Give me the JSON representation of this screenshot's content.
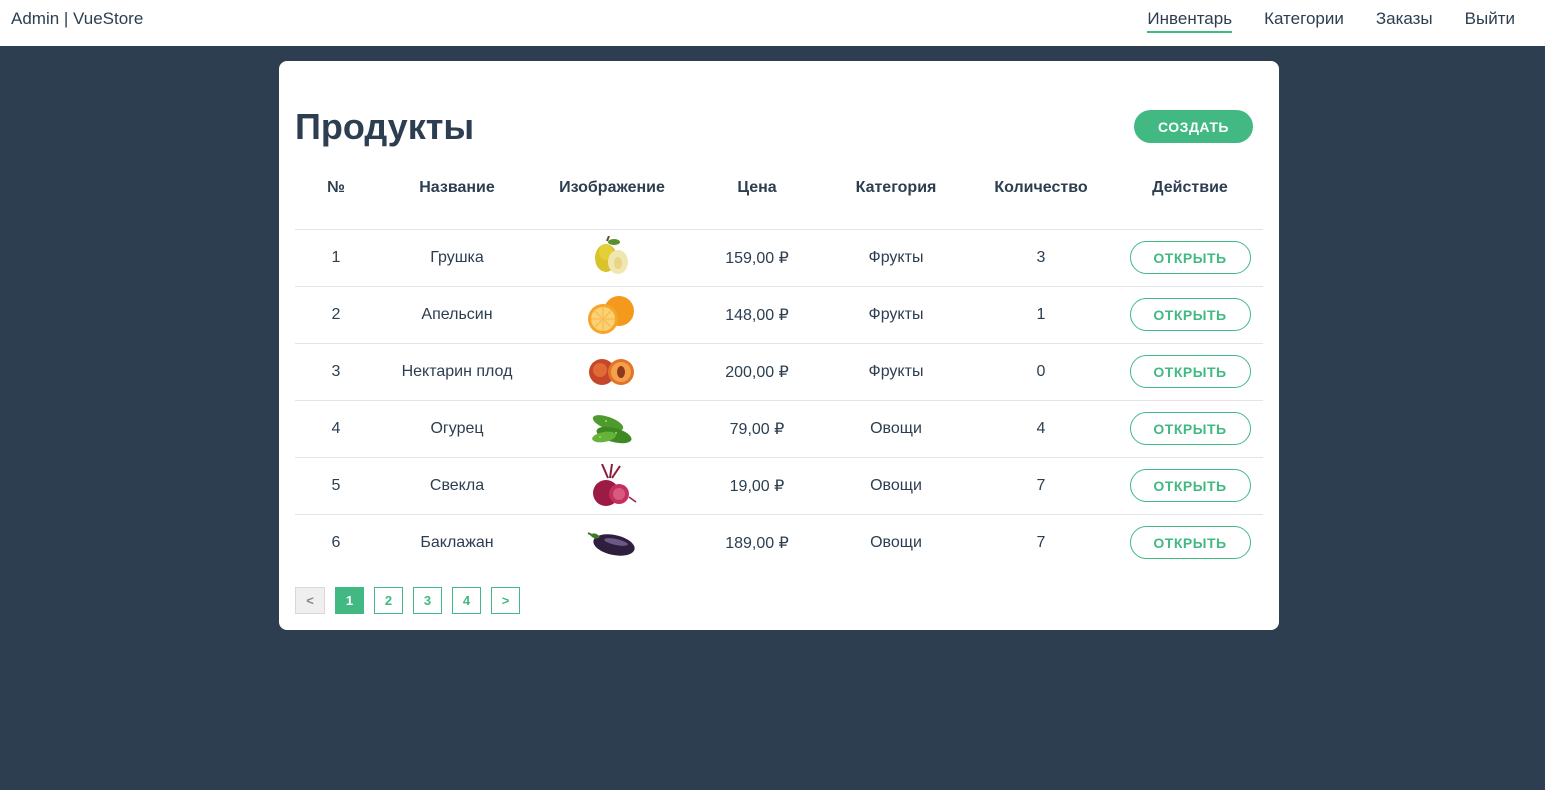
{
  "header": {
    "brand": "Admin | VueStore",
    "nav": [
      {
        "label": "Инвентарь",
        "active": true
      },
      {
        "label": "Категории",
        "active": false
      },
      {
        "label": "Заказы",
        "active": false
      },
      {
        "label": "Выйти",
        "active": false
      }
    ]
  },
  "main": {
    "title": "Продукты",
    "create_label": "СОЗДАТЬ",
    "columns": [
      "№",
      "Название",
      "Изображение",
      "Цена",
      "Категория",
      "Количество",
      "Действие"
    ],
    "rows": [
      {
        "num": "1",
        "name": "Грушка",
        "image": "pear",
        "price": "159,00 ₽",
        "category": "Фрукты",
        "qty": "3",
        "action": "ОТКРЫТЬ"
      },
      {
        "num": "2",
        "name": "Апельсин",
        "image": "orange",
        "price": "148,00 ₽",
        "category": "Фрукты",
        "qty": "1",
        "action": "ОТКРЫТЬ"
      },
      {
        "num": "3",
        "name": "Нектарин плод",
        "image": "nectarine",
        "price": "200,00 ₽",
        "category": "Фрукты",
        "qty": "0",
        "action": "ОТКРЫТЬ"
      },
      {
        "num": "4",
        "name": "Огурец",
        "image": "cucumber",
        "price": "79,00 ₽",
        "category": "Овощи",
        "qty": "4",
        "action": "ОТКРЫТЬ"
      },
      {
        "num": "5",
        "name": "Свекла",
        "image": "beet",
        "price": "19,00 ₽",
        "category": "Овощи",
        "qty": "7",
        "action": "ОТКРЫТЬ"
      },
      {
        "num": "6",
        "name": "Баклажан",
        "image": "eggplant",
        "price": "189,00 ₽",
        "category": "Овощи",
        "qty": "7",
        "action": "ОТКРЫТЬ"
      }
    ],
    "pagination": {
      "prev": "<",
      "pages": [
        "1",
        "2",
        "3",
        "4"
      ],
      "current": "1",
      "next": ">"
    }
  },
  "colors": {
    "accent": "#42b983",
    "background": "#2c3e50",
    "text": "#2c3e50"
  }
}
